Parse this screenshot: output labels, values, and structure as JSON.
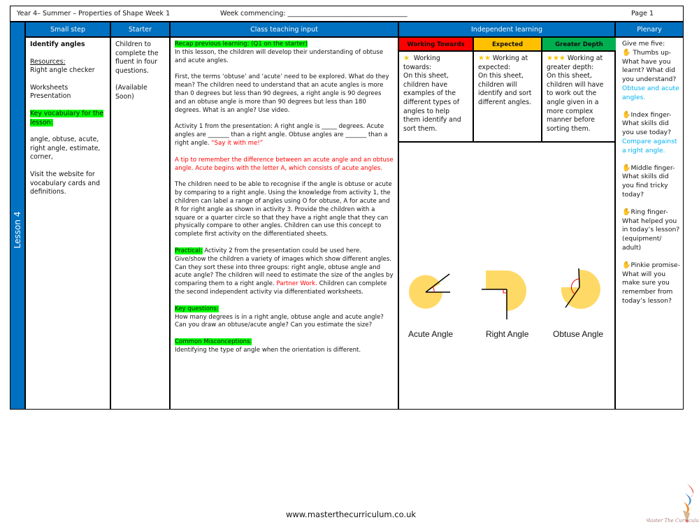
{
  "header": {
    "title": "Year 4– Summer – Properties of Shape Week 1",
    "week_commencing": "Week commencing: ____________________________________",
    "page": "Page 1"
  },
  "columns": {
    "small_step": "Small step",
    "starter": "Starter",
    "class_teaching": "Class teaching input",
    "independent": "Independent learning",
    "plenary": "Plenary"
  },
  "lesson_label": "Lesson 4",
  "small_step": {
    "title": "Identify angles",
    "resources_label": "Resources:",
    "resources": "Right angle checker",
    "worksheets": "Worksheets",
    "presentation": "Presentation",
    "vocab_label": "Key vocabulary for the lesson:",
    "vocab": "angle, obtuse, acute, right angle, estimate, corner,",
    "visit": "Visit the website for vocabulary cards and definitions."
  },
  "starter": {
    "text": "Children to complete the fluent in four questions.",
    "availability": "(Available Soon)"
  },
  "class_teaching": {
    "recap_label": "Recap previous learning: (Q1 on the starter)",
    "intro": "In this lesson, the children will develop their understanding of obtuse and acute angles.",
    "terms": "First, the terms ‘obtuse’ and ‘acute’ need to be explored. What do they mean? The children need to understand that an acute angles is more than 0 degrees but less than 90 degrees, a right angle is 90 degrees and an obtuse angle is more than 90 degrees but less than 180 degrees. What is an angle? Use video.",
    "activity1": "Activity 1 from the presentation:  A right angle is _____ degrees. Acute angles are _______ than a right angle. Obtuse angles are _______ than a right angle.",
    "say_it": "“Say it with me!”",
    "tip": "A tip to remember the difference between an acute angle and an obtuse angle. Acute begins with the letter A, which consists of acute angles.",
    "recognise": "The children need to be able to recognise if the angle is obtuse or acute by comparing to a right angle. Using the knowledge from activity 1, the children can label a range of angles using O for obtuse, A for acute and R for right angle as shown in activity 3. Provide the children with a square or a quarter circle so that they have a right angle that they can physically compare to other angles. Children can use this concept to complete first activity on the differentiated sheets.",
    "practical_label": "Practical:",
    "practical": " Activity 2 from the presentation could be used here. Give/show the children a variety of images which show different angles. Can they sort these into three groups: right angle, obtuse angle and acute angle? The children will need to estimate the size of the angles by comparing them to a right angle. ",
    "partner_work": "Partner Work.",
    "practical_end": " Children can complete the second independent activity via differentiated worksheets.",
    "key_questions_label": "Key questions:",
    "key_questions": "How many degrees is in a right angle, obtuse angle and acute angle? Can you draw an obtuse/acute angle? Can you estimate the size?",
    "misconceptions_label": "Common Misconceptions:",
    "misconceptions": "Identifying the type of angle when the orientation is different."
  },
  "independent": {
    "levels": [
      {
        "label": "Working Towards",
        "color": "#ff0000",
        "stars": "★",
        "heading": "Working towards:",
        "text": "On this sheet, children have examples of the different types of angles to help them identify and sort them."
      },
      {
        "label": "Expected",
        "color": "#ffc000",
        "stars": "★★",
        "heading": "Working at expected:",
        "text": "On this sheet, children will identify and sort different angles."
      },
      {
        "label": "Greater Depth",
        "color": "#00b050",
        "stars": "★★★",
        "heading": "Working at greater depth:",
        "text": "On this sheet, children will have to work out the angle given in a more complex manner before sorting them."
      }
    ],
    "angle_labels": [
      "Acute Angle",
      "Right Angle",
      "Obtuse Angle"
    ]
  },
  "plenary": {
    "intro": "Give me five:",
    "thumbs": "Thumbs up- What have you learnt? What did you understand?",
    "thumbs_answer": "Obtuse and acute angles.",
    "index": "Index finger- What skills did you use today?",
    "index_answer": "Compare against a right angle.",
    "middle": "Middle finger- What skills did you find tricky today?",
    "ring": "Ring finger- What helped you in today’s lesson? (equipment/ adult)",
    "pinkie": "Pinkie promise- What will you make sure you remember from today’s lesson?",
    "hand_icon": "✋"
  },
  "footer": {
    "url": "www.masterthecurriculum.co.uk",
    "logo_text": "Master The Curriculum"
  }
}
